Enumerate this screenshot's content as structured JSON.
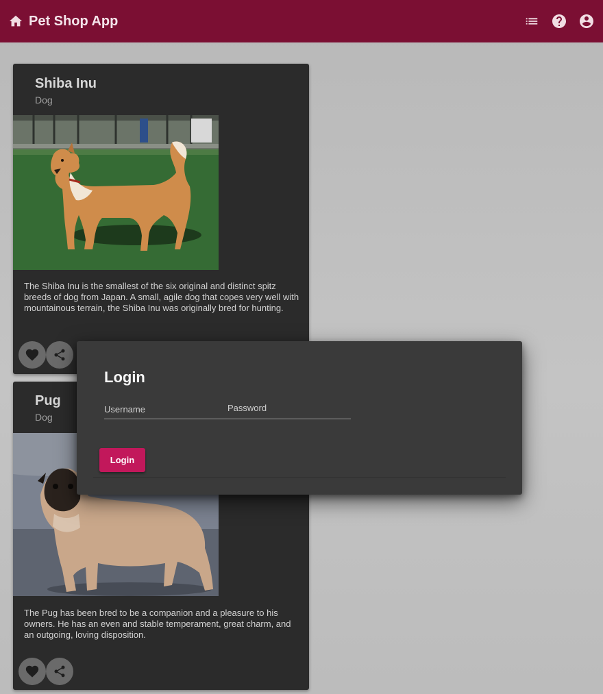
{
  "toolbar": {
    "title": "Pet Shop App",
    "icons": [
      "home-icon",
      "list-icon",
      "help-icon",
      "account-circle-icon"
    ],
    "color": "#7b0f33"
  },
  "cards": [
    {
      "title": "Shiba Inu",
      "subtitle": "Dog",
      "description": "The Shiba Inu is the smallest of the six original and distinct spitz breeds of dog from Japan. A small, agile dog that copes very well with mountainous terrain, the Shiba Inu was originally bred for hunting."
    },
    {
      "title": "Pug",
      "subtitle": "Dog",
      "description": "The Pug has been bred to be a companion and a pleasure to his owners. He has an even and stable temperament, great charm, and an outgoing, loving disposition."
    }
  ],
  "login_dialog": {
    "title": "Login",
    "username_label": "Username",
    "password_label": "Password",
    "username_value": "",
    "password_value": "",
    "button_label": "Login",
    "button_color": "#c2185b"
  }
}
